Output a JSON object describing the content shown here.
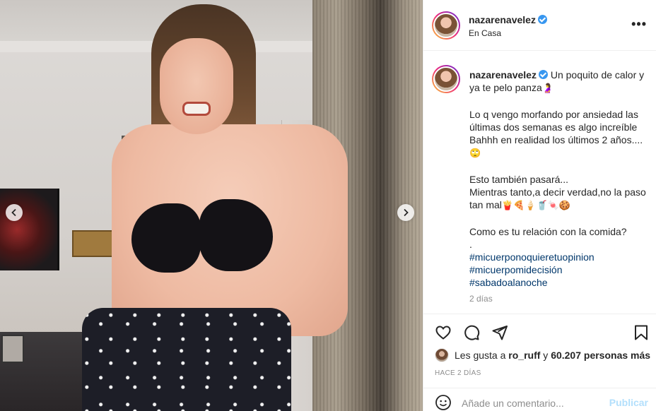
{
  "post": {
    "username": "nazarenavelez",
    "location": "En Casa",
    "more_label": "•••"
  },
  "caption": {
    "username": "nazarenavelez",
    "line1": "Un poquito de calor y ya te pelo panza",
    "emoji1": "🤰",
    "para2": "Lo q vengo morfando por ansiedad las últimas dos semanas es algo increíble Bahhh en realidad los últimos 2 años....",
    "emoji2": "🙄",
    "para3a": "Esto también pasará...",
    "para3b": "Mientras tanto,a decir verdad,no la paso tan mal",
    "emoji3": "🍟🍕🍦🥤🍬🍪",
    "para4": "Como es tu relación con la comida?",
    "dot": ".",
    "hashtags": [
      "#micuerponoquieretuopinion",
      "#micuerpomidecisión",
      "#sabadoalanoche"
    ],
    "time_ago": "2 días"
  },
  "likes": {
    "prefix": "Les gusta a",
    "user": "ro_ruff",
    "joiner": "y",
    "count_text": "60.207 personas más"
  },
  "posted": "HACE 2 DÍAS",
  "comment_box": {
    "placeholder": "Añade un comentario...",
    "publish_label": "Publicar"
  },
  "icons": {
    "verified": "verified-badge-icon",
    "heart": "heart-icon",
    "comment": "comment-icon",
    "share": "paper-plane-icon",
    "save": "bookmark-icon",
    "emoji": "smiley-icon",
    "prev": "chevron-left-icon",
    "next": "chevron-right-icon"
  },
  "colors": {
    "verified_blue": "#3897f0",
    "hashtag": "#00376b",
    "muted": "#8e8e8e",
    "publish_disabled": "#b2dffc"
  }
}
